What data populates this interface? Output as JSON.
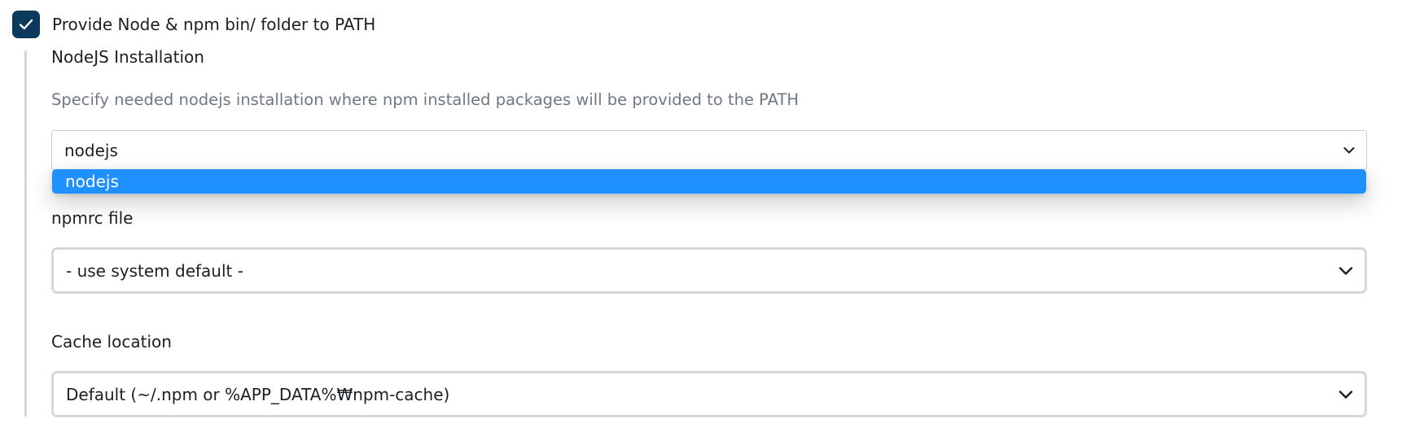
{
  "provide_path": {
    "label": "Provide Node & npm bin/ folder to PATH",
    "checked": true
  },
  "nodejs_installation": {
    "label": "NodeJS Installation",
    "description": "Specify needed nodejs installation where npm installed packages will be provided to the PATH",
    "selected": "nodejs",
    "options": [
      "nodejs"
    ]
  },
  "npmrc_file": {
    "label": "npmrc file",
    "selected": "- use system default -"
  },
  "cache_location": {
    "label": "Cache location",
    "selected": "Default (~/.npm or %APP_DATA%₩npm-cache)"
  },
  "icons": {
    "checkbox": "checkmark-icon",
    "select": "chevron-down-icon"
  },
  "colors": {
    "checkbox_fill": "#0b3a5c",
    "option_highlight": "#1e90ff",
    "description_text": "#6f7884"
  }
}
